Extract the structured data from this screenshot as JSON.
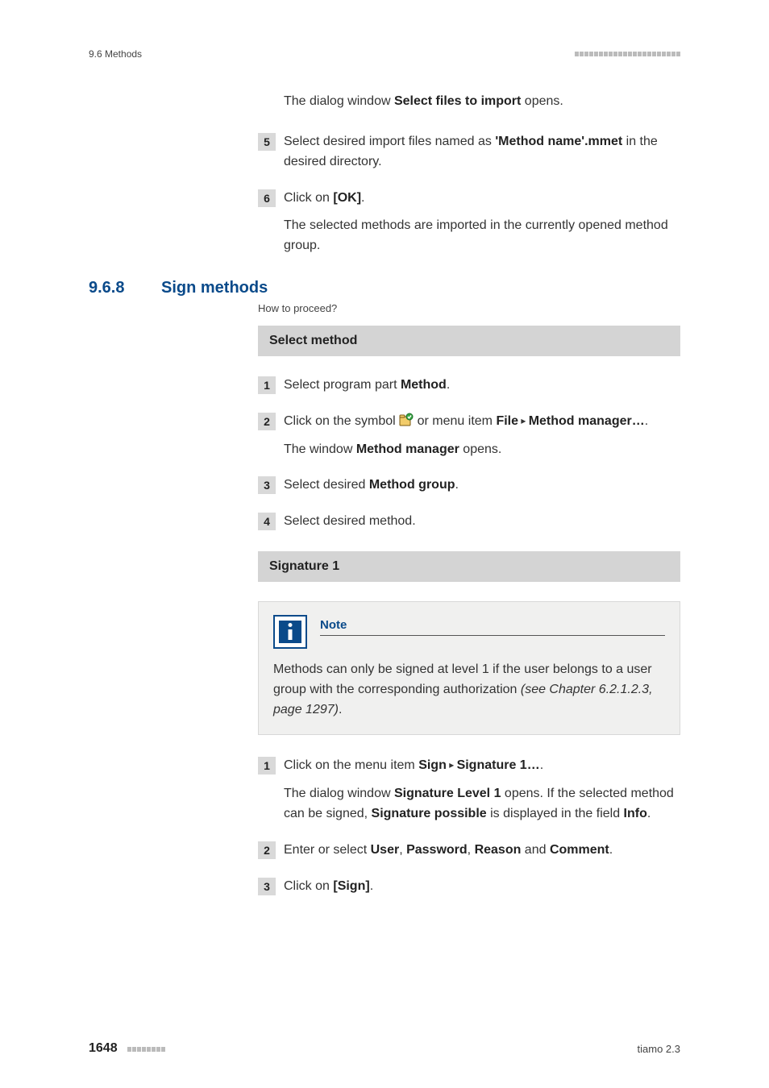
{
  "header": {
    "section_ref": "9.6 Methods"
  },
  "intro_step4_tail": {
    "pre": "The dialog window ",
    "bold": "Select files to import",
    "post": " opens."
  },
  "steps_top": {
    "s5": {
      "num": "5",
      "pre": "Select desired import files named as ",
      "bold": "'Method name'.mmet",
      "post": " in the desired directory."
    },
    "s6": {
      "num": "6",
      "line1_pre": "Click on ",
      "line1_bold": "[OK]",
      "line1_post": ".",
      "line2": "The selected methods are imported in the currently opened method group."
    }
  },
  "section": {
    "num": "9.6.8",
    "title": "Sign methods",
    "howto": "How to proceed?"
  },
  "bar1": "Select method",
  "select_method": {
    "s1": {
      "num": "1",
      "pre": "Select program part ",
      "bold": "Method",
      "post": "."
    },
    "s2": {
      "num": "2",
      "line1_a": "Click on the symbol ",
      "line1_b": " or menu item ",
      "line1_bold1": "File",
      "line1_tri": " ▸ ",
      "line1_bold2": "Method manager…",
      "line1_post": ".",
      "line2_pre": "The window ",
      "line2_bold": "Method manager",
      "line2_post": " opens."
    },
    "s3": {
      "num": "3",
      "pre": "Select desired ",
      "bold": "Method group",
      "post": "."
    },
    "s4": {
      "num": "4",
      "text": "Select desired method."
    }
  },
  "bar2": "Signature 1",
  "note": {
    "title": "Note",
    "text_pre": "Methods can only be signed at level 1 if the user belongs to a user group with the corresponding authorization ",
    "text_italic": "(see Chapter 6.2.1.2.3, page 1297)",
    "text_post": "."
  },
  "sig_steps": {
    "s1": {
      "num": "1",
      "line1_pre": "Click on the menu item ",
      "line1_bold1": "Sign",
      "line1_tri": " ▸ ",
      "line1_bold2": "Signature 1…",
      "line1_post": ".",
      "line2_a": "The dialog window ",
      "line2_bold1": "Signature Level 1",
      "line2_b": " opens. If the selected method can be signed, ",
      "line2_bold2": "Signature possible",
      "line2_c": " is displayed in the field ",
      "line2_bold3": "Info",
      "line2_d": "."
    },
    "s2": {
      "num": "2",
      "pre": "Enter or select ",
      "b1": "User",
      "c1": ", ",
      "b2": "Password",
      "c2": ", ",
      "b3": "Reason",
      "c3": " and ",
      "b4": "Comment",
      "post": "."
    },
    "s3": {
      "num": "3",
      "pre": "Click on ",
      "bold": "[Sign]",
      "post": "."
    }
  },
  "footer": {
    "page": "1648",
    "product": "tiamo 2.3"
  }
}
